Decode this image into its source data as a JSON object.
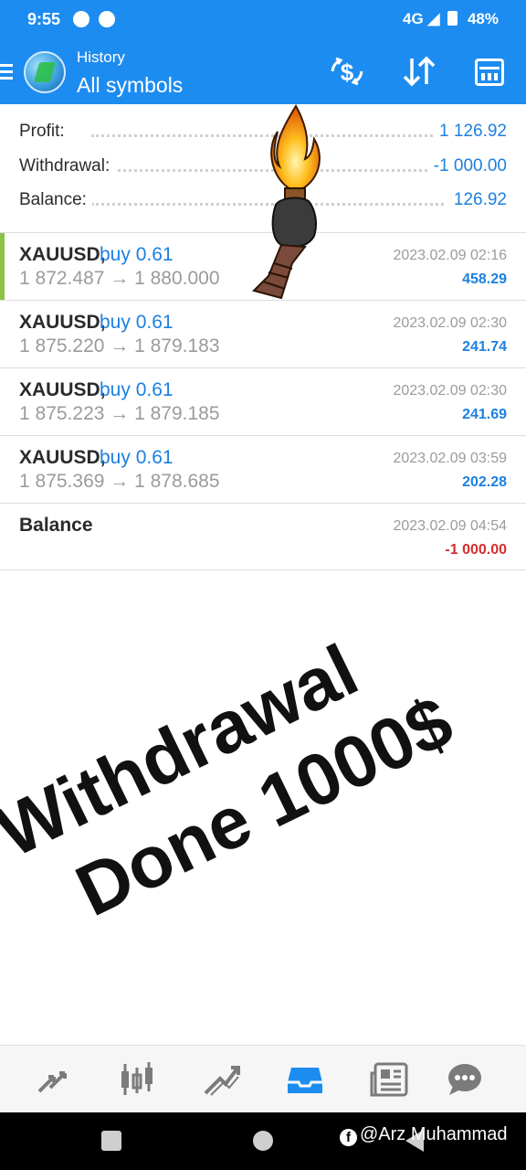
{
  "status_bar": {
    "time": "9:55",
    "network": "4G",
    "battery": "48%"
  },
  "header": {
    "subtitle": "History",
    "title": "All symbols",
    "icons": [
      "menu-icon",
      "metatrader-logo",
      "currency-exchange-icon",
      "sort-icon",
      "calendar-icon"
    ]
  },
  "summary": [
    {
      "label": "Profit:",
      "value": "1 126.92"
    },
    {
      "label": "Withdrawal:",
      "value": "-1 000.00"
    },
    {
      "label": "Balance:",
      "value": "126.92"
    }
  ],
  "deals": [
    {
      "symbol": "XAUUSD,",
      "type": "buy 0.61",
      "prices": "1 872.487 → 1 880.000",
      "time": "2023.02.09 02:16",
      "profit": "458.29"
    },
    {
      "symbol": "XAUUSD,",
      "type": "buy 0.61",
      "prices": "1 875.220 → 1 879.183",
      "time": "2023.02.09 02:30",
      "profit": "241.74"
    },
    {
      "symbol": "XAUUSD,",
      "type": "buy 0.61",
      "prices": "1 875.223 → 1 879.185",
      "time": "2023.02.09 02:30",
      "profit": "241.69"
    },
    {
      "symbol": "XAUUSD,",
      "type": "buy 0.61",
      "prices": "1 875.369 → 1 878.685",
      "time": "2023.02.09 03:59",
      "profit": "202.28"
    }
  ],
  "balance_entry": {
    "label": "Balance",
    "time": "2023.02.09 04:54",
    "amount": "-1 000.00"
  },
  "overlay": {
    "line1": "Withdrawal",
    "line2": "Done 1000$"
  },
  "toolbar": {
    "icons": [
      "quotes-icon",
      "chart-icon",
      "trade-icon",
      "history-icon",
      "news-icon",
      "messages-icon"
    ],
    "active": "history-icon"
  },
  "watermark": {
    "text": "@Arz Muhammad"
  },
  "colors": {
    "header_bg": "#1d8cf0",
    "accent_blue": "#1d80e0",
    "negative_red": "#d32f2f",
    "active_deal_bar": "#8bc34a"
  }
}
